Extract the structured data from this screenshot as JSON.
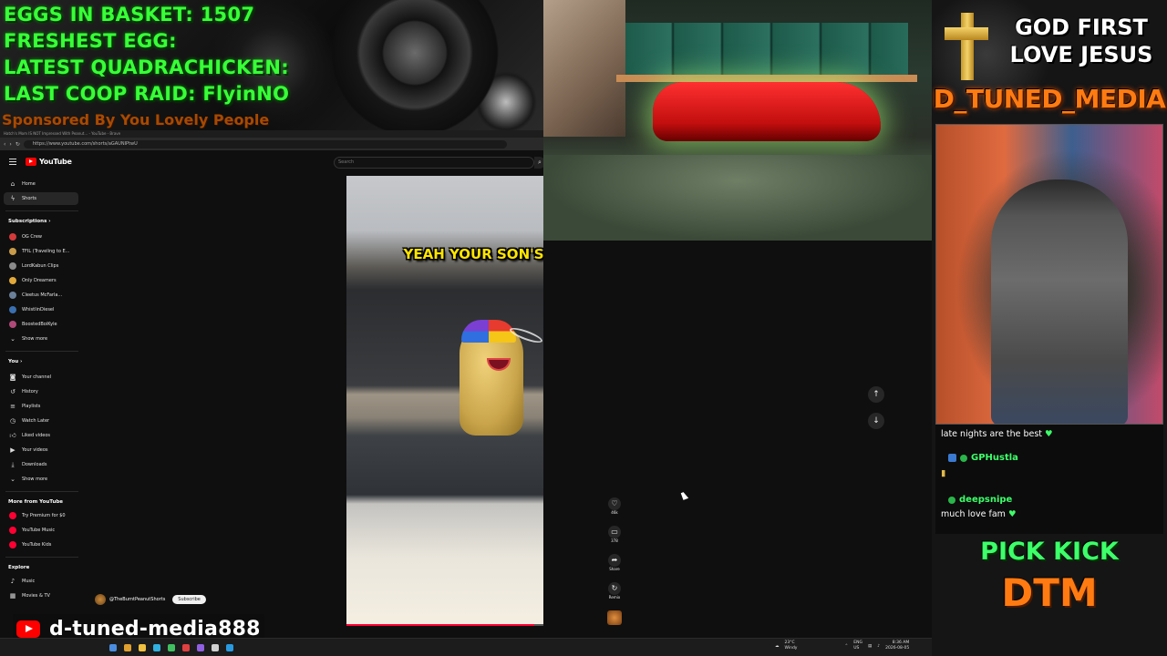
{
  "banner": {
    "line1": "EGGS IN BASKET: 1507",
    "line2": "FRESHEST EGG:",
    "line3": "LATEST QUADRACHICKEN:",
    "line4": "LAST COOP RAID: FlyinNO",
    "sponsor": "Sponsored By You Lovely People"
  },
  "browser": {
    "tab_title": "Hatch's Mom IS NOT Impressed With Peanut... - YouTube - Brave",
    "url": "https://www.youtube.com/shorts/aGAUNIPtwU"
  },
  "youtube": {
    "logo_text": "YouTube",
    "search_placeholder": "Search",
    "sidebar": {
      "home": "Home",
      "shorts": "Shorts",
      "subscriptions_header": "Subscriptions",
      "subs": [
        {
          "label": "OG Crew",
          "color": "#d43a3a"
        },
        {
          "label": "TFIL (Traveling to E...",
          "color": "#c79b4a"
        },
        {
          "label": "LordKabun Clips",
          "color": "#8a8a8a"
        },
        {
          "label": "Only Dreamers",
          "color": "#e0a93a"
        },
        {
          "label": "Cleetus McFarla...",
          "color": "#6a7f9a"
        },
        {
          "label": "WhistlinDiesel",
          "color": "#3a6fb0"
        },
        {
          "label": "BoostedBoiKyle",
          "color": "#b04a7a"
        }
      ],
      "show_more_1": "Show more",
      "you_header": "You",
      "you_items": [
        "Your channel",
        "History",
        "Playlists",
        "Watch Later",
        "Liked videos",
        "Your videos",
        "Downloads"
      ],
      "show_more_2": "Show more",
      "more_header": "More from YouTube",
      "more_items": [
        "Try Premium for $0",
        "YouTube Music",
        "YouTube Kids"
      ],
      "explore_header": "Explore",
      "explore_items": [
        "Music",
        "Movies & TV"
      ]
    },
    "short": {
      "caption": "YEAH YOUR SON'S",
      "channel": "@TheBurntPeanutShorts",
      "subscribe": "Subscribe",
      "likes": "46k",
      "comments": "378",
      "share": "Share",
      "remix": "Remix",
      "progress": 0.74
    }
  },
  "right_panel": {
    "god_line1": "GOD FIRST",
    "god_line2": "LOVE JESUS",
    "brand": "D_TUNED_MEDIA",
    "chat": {
      "msg1": "late nights are the best",
      "user1": "GPHustla",
      "user2": "deepsnipe",
      "msg2": "much love fam"
    },
    "pick_kick": "PICK KICK",
    "dtm": "DTM"
  },
  "branding": {
    "handle": "d-tuned-media888"
  },
  "taskbar": {
    "weather_temp": "23°C",
    "weather_desc": "Windy",
    "lang": "ENG",
    "region": "US",
    "time": "8:36 AM",
    "date": "2026-08-05"
  },
  "icons": {
    "heart": "heart-icon",
    "cross": "gold-cross-icon",
    "youtube": "youtube-play-icon"
  }
}
